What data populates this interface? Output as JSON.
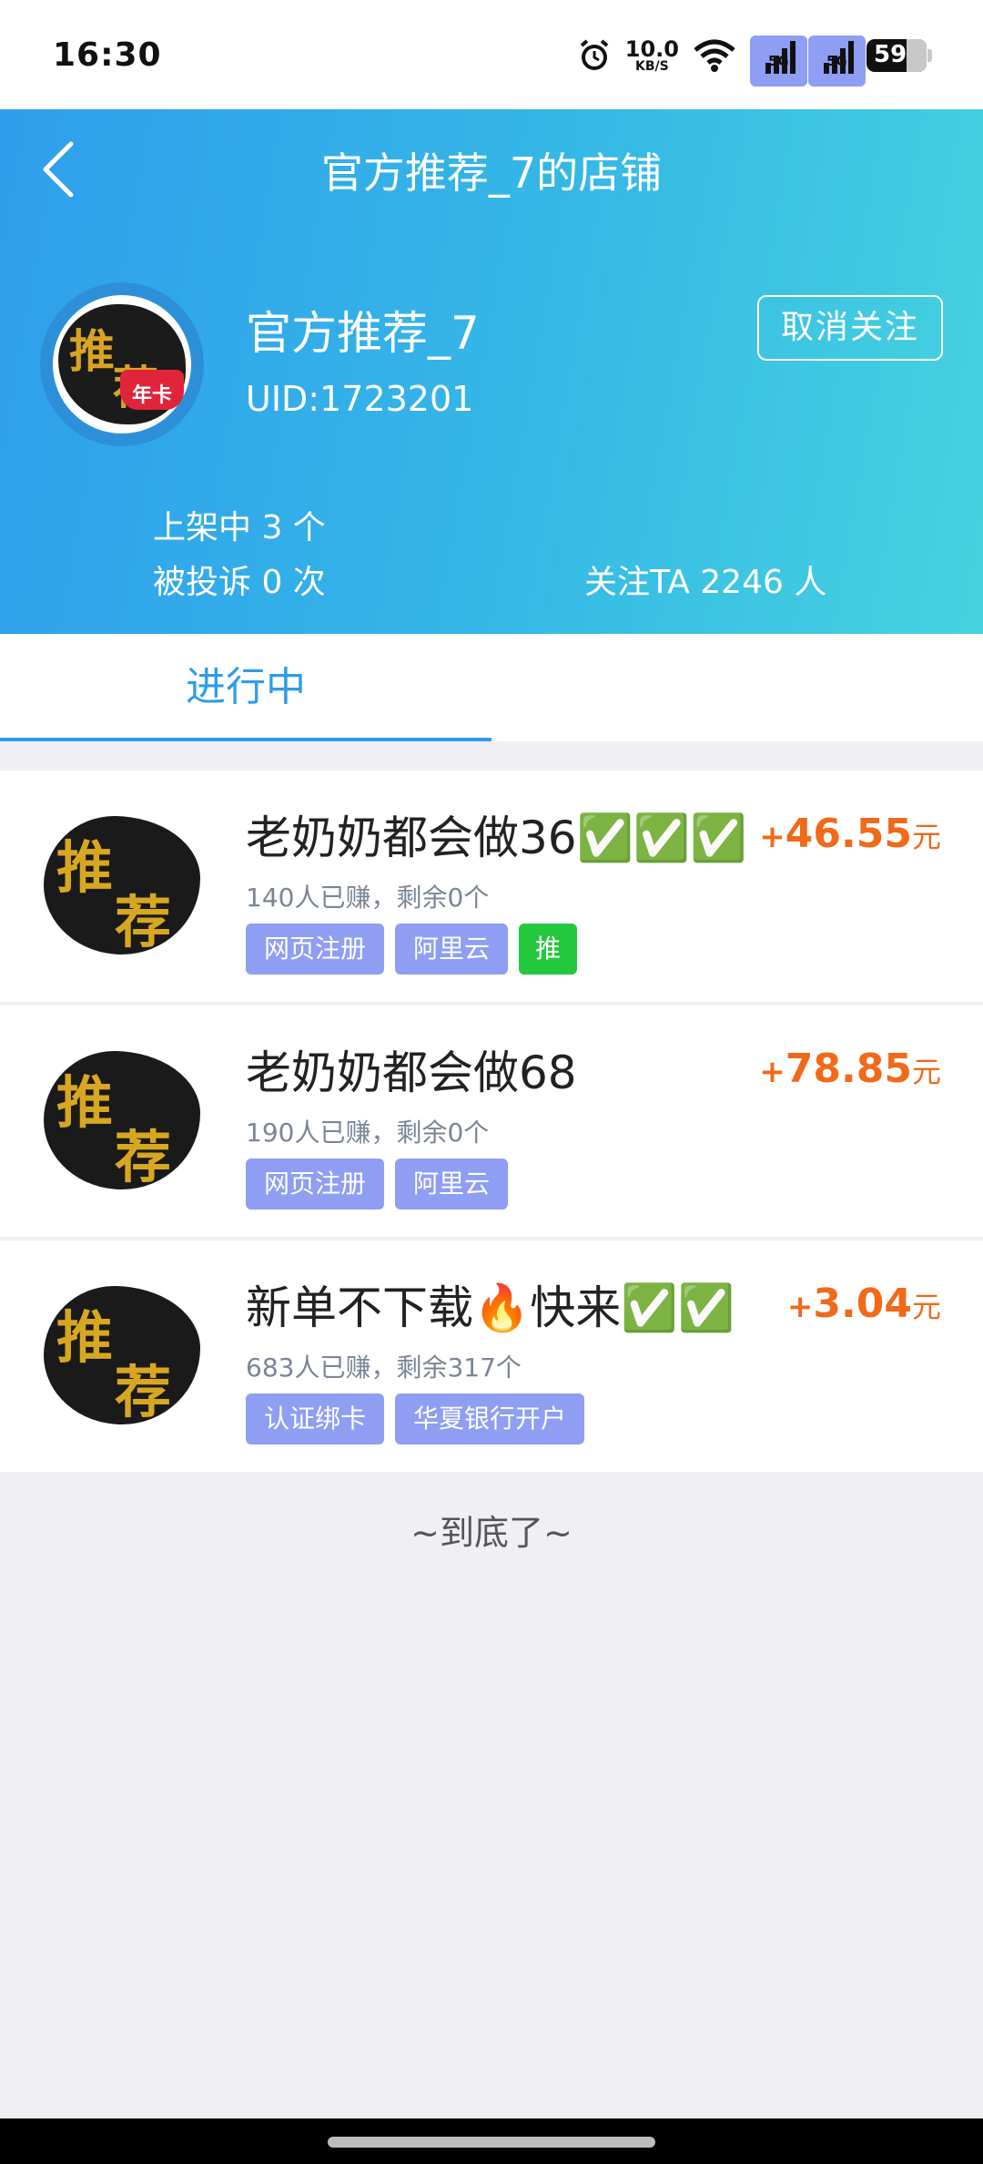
{
  "status_bar": {
    "time": "16:30",
    "net_speed_value": "10.0",
    "net_speed_unit": "KB/S",
    "signal_1": "5G",
    "signal_2": "5G",
    "battery": "59"
  },
  "header": {
    "title": "官方推荐_7的店铺",
    "shop_name": "官方推荐_7",
    "uid": "UID:1723201",
    "unfollow_label": "取消关注",
    "avatar_char_1": "推",
    "avatar_char_2": "荐",
    "avatar_badge": "年卡",
    "stat_on_shelf": "上架中 3 个",
    "stat_complaints": "被投诉 0 次",
    "stat_followers": "关注TA 2246 人"
  },
  "tabs": [
    {
      "label": "进行中",
      "active": true
    }
  ],
  "tasks": [
    {
      "title": "老奶奶都会做36",
      "title_emoji": "✅✅✅",
      "meta": "140人已赚，剩余0个",
      "price_plus": "+",
      "price": "46.55",
      "price_unit": "元",
      "tags": [
        "网页注册",
        "阿里云"
      ],
      "badge": "推",
      "thumb_char_1": "推",
      "thumb_char_2": "荐"
    },
    {
      "title": "老奶奶都会做68",
      "meta": "190人已赚，剩余0个",
      "price_plus": "+",
      "price": "78.85",
      "price_unit": "元",
      "tags": [
        "网页注册",
        "阿里云"
      ],
      "thumb_char_1": "推",
      "thumb_char_2": "荐"
    },
    {
      "title": "新单不下载",
      "title_fire": "🔥",
      "title_suffix": "快来",
      "title_emoji": "✅✅",
      "meta": "683人已赚，剩余317个",
      "price_plus": "+",
      "price": "3.04",
      "price_unit": "元",
      "tags": [
        "认证绑卡",
        "华夏银行开户"
      ],
      "thumb_char_1": "推",
      "thumb_char_2": "荐"
    }
  ],
  "end_text": "~到底了~",
  "colors": {
    "header_gradient_start": "#2f9eec",
    "header_gradient_end": "#46d3df",
    "tab_active": "#2d9ce8",
    "price": "#f06a1a",
    "tag_bg": "#8f9ef3",
    "badge_green": "#23c83d"
  },
  "icons": [
    "alarm-clock-icon",
    "wifi-icon",
    "signal-icon",
    "battery-icon",
    "back-arrow-icon"
  ]
}
